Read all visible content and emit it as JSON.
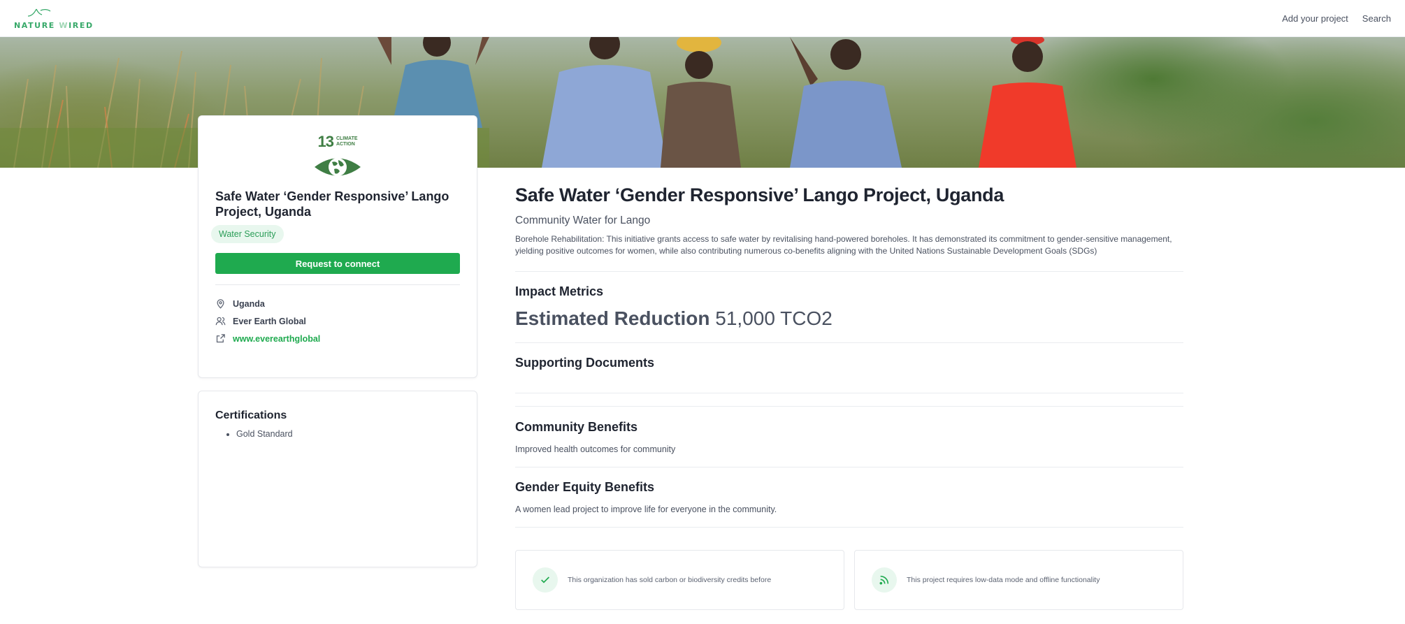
{
  "header": {
    "logo": {
      "word1": "NATURE",
      "word2_dim": "W",
      "word2_rest": "IRED"
    },
    "nav": [
      "Add your project",
      "Search"
    ]
  },
  "sidebar_card": {
    "sdg": {
      "number": "13",
      "label_line1": "CLIMATE",
      "label_line2": "ACTION",
      "color": "#3f7e44"
    },
    "title": "Safe Water ‘Gender Responsive’ Lango Project, Uganda",
    "badge": "Water Security",
    "connect_button": "Request to connect",
    "info": {
      "location": "Uganda",
      "organization": "Ever Earth Global",
      "website": "www.everearthglobal"
    }
  },
  "certifications": {
    "title": "Certifications",
    "items": [
      "Gold Standard"
    ]
  },
  "main": {
    "title": "Safe Water ‘Gender Responsive’ Lango Project, Uganda",
    "subtitle": "Community Water for Lango",
    "description": "Borehole Rehabilitation: This initiative grants access to safe water by revitalising hand-powered boreholes. It has demonstrated its commitment to gender-sensitive management, yielding positive outcomes for women, while also contributing numerous co-benefits aligning with the United Nations Sustainable Development Goals (SDGs)",
    "impact": {
      "heading": "Impact Metrics",
      "metric_label": "Estimated Reduction",
      "metric_value": "51,000 TCO2"
    },
    "documents": {
      "heading": "Supporting Documents"
    },
    "community": {
      "heading": "Community Benefits",
      "text": "Improved health outcomes for community"
    },
    "gender": {
      "heading": "Gender Equity Benefits",
      "text": "A women lead project to improve life for everyone in the community."
    },
    "features": [
      {
        "icon": "check-icon",
        "text": "This organization has sold carbon or biodiversity credits before"
      },
      {
        "icon": "signal-icon",
        "text": "This project requires low-data mode and offline functionality"
      }
    ]
  },
  "colors": {
    "brand": "#1faa4f",
    "badge_bg": "#e8f7ee",
    "text": "#1f2430"
  }
}
